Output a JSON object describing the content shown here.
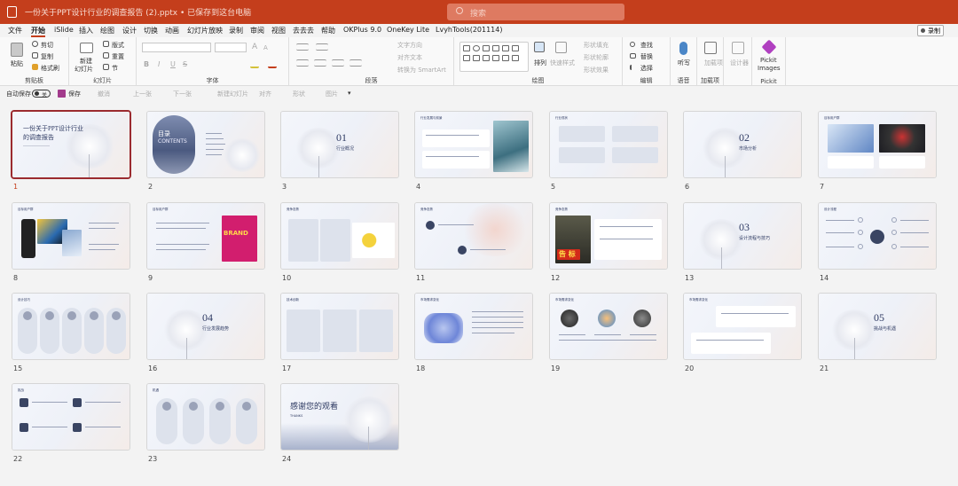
{
  "titlebar": {
    "doc_title": "一份关于PPT设计行业的调查报告 (2).pptx • 已保存到这台电脑",
    "search_placeholder": "搜索"
  },
  "tabs": [
    "文件",
    "开始",
    "iSlide",
    "插入",
    "绘图",
    "设计",
    "切换",
    "动画",
    "幻灯片放映",
    "录制",
    "审阅",
    "视图",
    "去去去",
    "帮助",
    "OKPlus 9.0",
    "OneKey Lite",
    "LvyhTools(201114)"
  ],
  "active_tab": "开始",
  "record_button": "录制",
  "ribbon": {
    "clipboard": {
      "paste": "粘贴",
      "cut": "剪切",
      "copy": "复制",
      "format_painter": "格式刷",
      "label": "剪贴板"
    },
    "slides": {
      "new_slide": "新建",
      "new_slide_2": "幻灯片",
      "layout": "版式",
      "reset": "重置",
      "section": "节",
      "label": "幻灯片"
    },
    "font": {
      "label": "字体",
      "bold": "B",
      "italic": "I",
      "underline": "U",
      "strike": "S",
      "a_size_up": "A",
      "a_size_down": "A"
    },
    "paragraph": {
      "text_direction": "文字方向",
      "align_text": "对齐文本",
      "smartart": "转换为 SmartArt",
      "label": "段落"
    },
    "drawing": {
      "arrange": "排列",
      "quick_styles": "快速样式",
      "shape_fill": "形状填充",
      "shape_outline": "形状轮廓",
      "shape_effects": "形状效果",
      "label": "绘图"
    },
    "editing": {
      "find": "查找",
      "replace": "替换",
      "select": "选择",
      "label": "编辑"
    },
    "voice": {
      "dictate": "听写",
      "label": "语音"
    },
    "addins": {
      "addin": "加载项",
      "label": "加载项"
    },
    "designer": {
      "label": "设计器"
    },
    "pickit": {
      "label1": "Pickit",
      "label2": "Images",
      "group": "Pickit"
    }
  },
  "qat": {
    "autosave": "自动保存",
    "toggle_state": "关",
    "save": "保存",
    "undo": "撤消",
    "prev": "上一张",
    "next": "下一张",
    "new_slide": "新建幻灯片",
    "align": "对齐",
    "shape": "形状",
    "clip": "图片"
  },
  "selected_slide": 1,
  "slides": [
    {
      "num": "1",
      "title": "一份关于PPT设计行业的调查报告"
    },
    {
      "num": "2",
      "title": "目录 CONTENTS"
    },
    {
      "num": "3",
      "title": "01 行业概况"
    },
    {
      "num": "4",
      "title": "行业发展与前景"
    },
    {
      "num": "5",
      "title": "行业现状"
    },
    {
      "num": "6",
      "title": "02 市场分析"
    },
    {
      "num": "7",
      "title": "目标用户群"
    },
    {
      "num": "8",
      "title": "目标用户群"
    },
    {
      "num": "9",
      "title": "目标用户群"
    },
    {
      "num": "10",
      "title": "竞争态势"
    },
    {
      "num": "11",
      "title": "竞争态势"
    },
    {
      "num": "12",
      "title": "竞争态势"
    },
    {
      "num": "13",
      "title": "03 设计流程与技巧"
    },
    {
      "num": "14",
      "title": "设计流程"
    },
    {
      "num": "15",
      "title": "设计技巧"
    },
    {
      "num": "16",
      "title": "04 行业发展趋势"
    },
    {
      "num": "17",
      "title": "技术创新"
    },
    {
      "num": "18",
      "title": "市场需求变化"
    },
    {
      "num": "19",
      "title": "市场需求变化"
    },
    {
      "num": "20",
      "title": "市场需求变化"
    },
    {
      "num": "21",
      "title": "05 挑战与机遇"
    },
    {
      "num": "22",
      "title": "挑战"
    },
    {
      "num": "23",
      "title": "机遇"
    },
    {
      "num": "24",
      "title": "感谢您的观看"
    }
  ],
  "slide_text": {
    "s1_title_1": "一份关于PPT设计行业",
    "s1_title_2": "的调查报告",
    "s2_big": "目录",
    "s2_big2": "CONTENTS",
    "s3_num": "01",
    "s3_title": "行业概况",
    "s6_num": "02",
    "s6_title": "市场分析",
    "s9_brand": "BRAND",
    "s12_sign": "告 标",
    "s13_num": "03",
    "s13_title": "设计流程与技巧",
    "s16_num": "04",
    "s16_title": "行业发展趋势",
    "s21_num": "05",
    "s21_title": "挑战与机遇",
    "s24_title": "感谢您的观看",
    "s24_sub": "THANKS"
  },
  "colors": {
    "accent": "#c43e1c",
    "title_navy": "#2f3b63",
    "selection": "#9b2b2f"
  }
}
